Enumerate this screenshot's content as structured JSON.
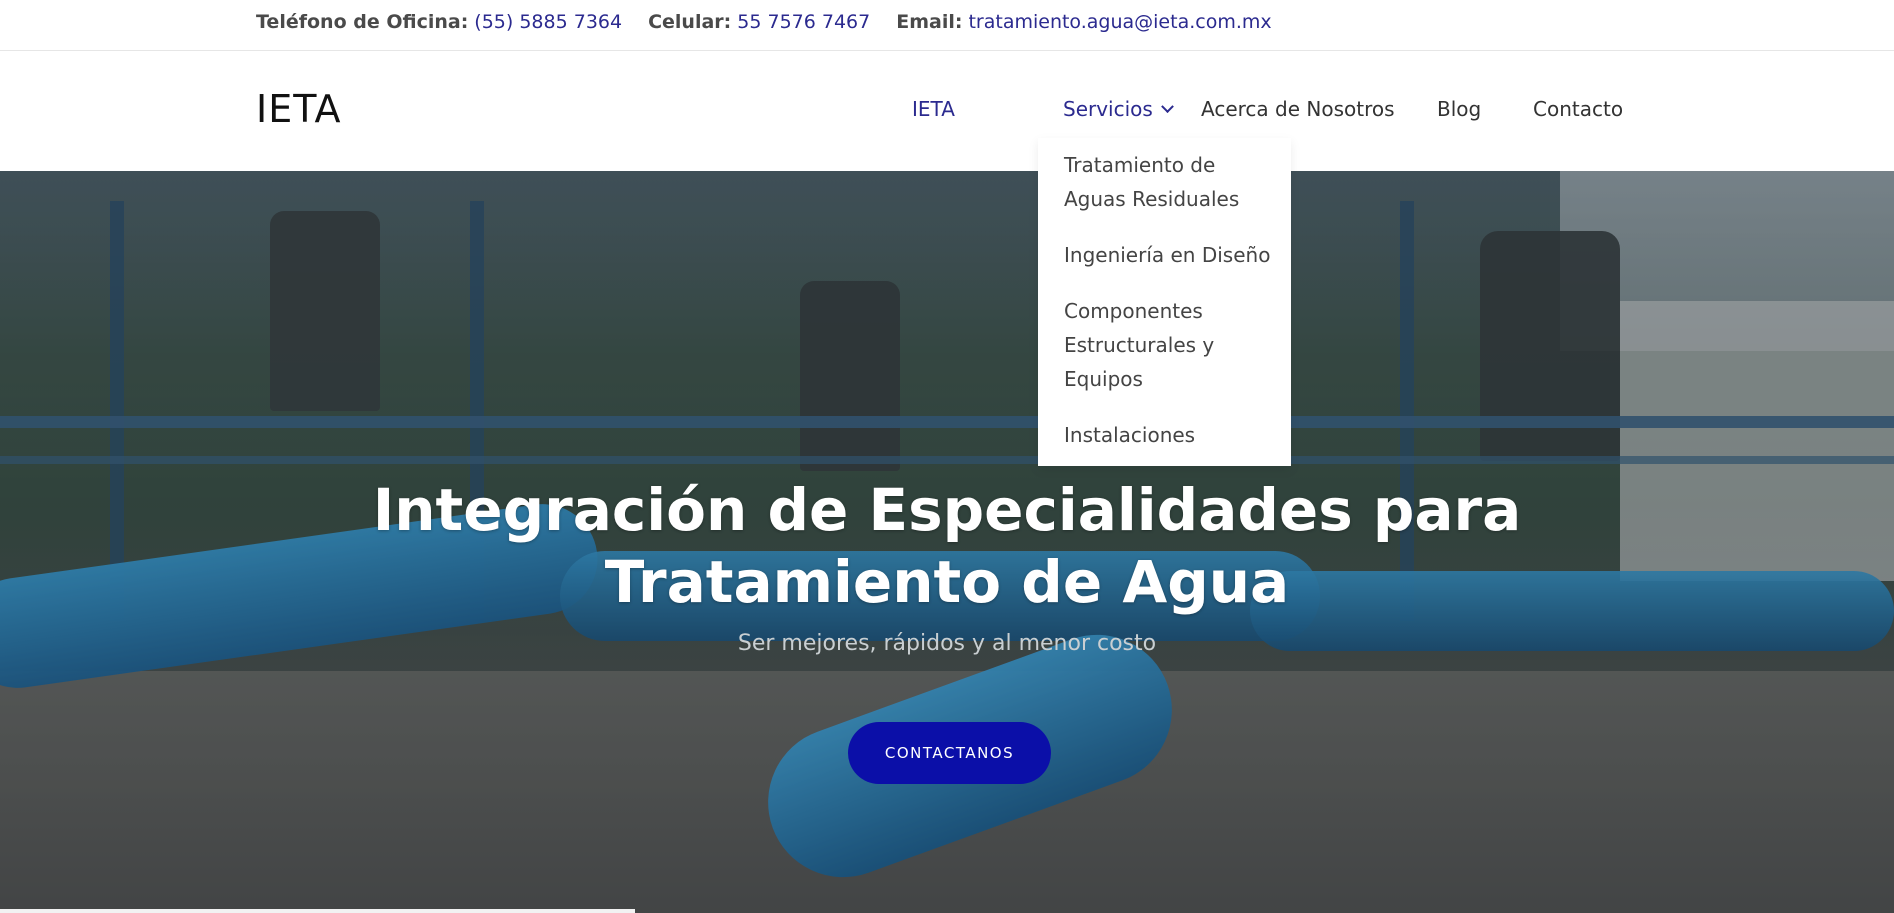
{
  "topbar": {
    "office_label": "Teléfono de Oficina:",
    "office_value": "(55) 5885 7364",
    "cell_label": "Celular:",
    "cell_value": "55 7576 7467",
    "email_label": "Email:",
    "email_value": "tratamiento.agua@ieta.com.mx"
  },
  "header": {
    "logo": "IETA",
    "nav": {
      "ieta": "IETA",
      "servicios": "Servicios",
      "acerca": "Acerca de Nosotros",
      "blog": "Blog",
      "contacto": "Contacto"
    }
  },
  "dropdown": {
    "items": [
      "Tratamiento de Aguas Residuales",
      "Ingeniería en Diseño",
      "Componentes Estructurales y Equipos",
      "Instalaciones"
    ]
  },
  "hero": {
    "title_line1": "Integración de Especialidades para",
    "title_line2": "Tratamiento de Agua",
    "subtitle": "Ser mejores, rápidos y al menor costo",
    "cta": "CONTACTANOS"
  },
  "colors": {
    "accent": "#2b2a8f",
    "cta_bg": "#0b0fa8",
    "underline": "#1212b5"
  }
}
